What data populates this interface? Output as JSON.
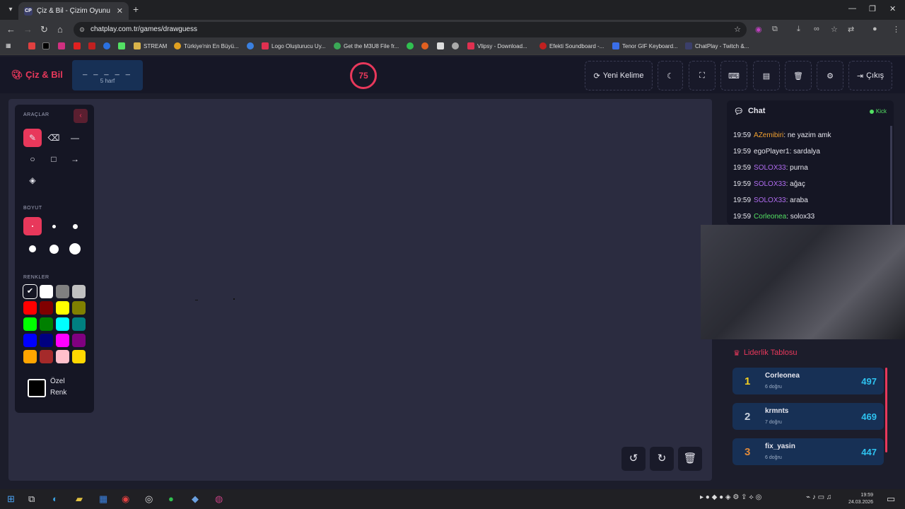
{
  "browser": {
    "tab_title": "Çiz & Bil - Çizim Oyunu",
    "tab_favicon": "CP",
    "url": "chatplay.com.tr/games/drawguess",
    "bookmarks": [
      {
        "label": "STREAM",
        "color": "#d9b44a"
      },
      {
        "label": "Türkiye'nin En Büyü...",
        "color": "#e0a020"
      },
      {
        "label": "Logo Oluşturucu Uy...",
        "color": "#e03050"
      },
      {
        "label": "Get the M3U8 File fr...",
        "color": "#3aa856"
      },
      {
        "label": "Vlipsy - Download...",
        "color": "#e03050"
      },
      {
        "label": "Efekti Soundboard -...",
        "color": "#c02020"
      },
      {
        "label": "Tenor GIF Keyboard...",
        "color": "#3a6ee8"
      },
      {
        "label": "ChatPlay - Twitch &...",
        "color": "#3b3f6a"
      }
    ]
  },
  "header": {
    "logo": "Çiz & Bil",
    "word_mask": "_ _ _ _ _",
    "word_length": "5 harf",
    "timer": "75",
    "new_word_label": "Yeni Kelime",
    "exit_label": "Çıkış"
  },
  "tools": {
    "tools_label": "ARAÇLAR",
    "size_label": "BOYUT",
    "colors_label": "RENKLER",
    "custom_color_line1": "Özel",
    "custom_color_line2": "Renk",
    "palette": [
      "#000000",
      "#ffffff",
      "#808080",
      "#c0c0c0",
      "#ff0000",
      "#800000",
      "#ffff00",
      "#808000",
      "#00ff00",
      "#008000",
      "#00ffff",
      "#008080",
      "#0000ff",
      "#000080",
      "#ff00ff",
      "#800080",
      "#ffa500",
      "#a52a2a",
      "#ffc0cb",
      "#ffd700"
    ]
  },
  "chat": {
    "title": "Chat",
    "platform": "Kick",
    "messages": [
      {
        "time": "19:59",
        "user": "AZemibiri",
        "text": ": ne yazim amk",
        "color": "#f0a030"
      },
      {
        "time": "19:59",
        "user": "egoPlayer1",
        "text": ": sardalya",
        "color": "#e6e6ee"
      },
      {
        "time": "19:59",
        "user": "SOLOX33",
        "text": ": purna",
        "color": "#b06cf0"
      },
      {
        "time": "19:59",
        "user": "SOLOX33",
        "text": ": ağaç",
        "color": "#b06cf0"
      },
      {
        "time": "19:59",
        "user": "SOLOX33",
        "text": ": araba",
        "color": "#b06cf0"
      },
      {
        "time": "19:59",
        "user": "Corleonea",
        "text": ": solox33",
        "color": "#53e063"
      }
    ]
  },
  "leaderboard": {
    "title": "Liderlik Tablosu",
    "rows": [
      {
        "rank": "1",
        "name": "Corleonea",
        "sub": "6 doğru",
        "score": "497",
        "rank_color": "#f5d020"
      },
      {
        "rank": "2",
        "name": "krmnts",
        "sub": "7 doğru",
        "score": "469",
        "rank_color": "#c8d0dc"
      },
      {
        "rank": "3",
        "name": "fix_yasin",
        "sub": "6 doğru",
        "score": "447",
        "rank_color": "#e08a3a"
      }
    ]
  },
  "taskbar": {
    "time": "19:59",
    "date": "24.03.2026"
  }
}
